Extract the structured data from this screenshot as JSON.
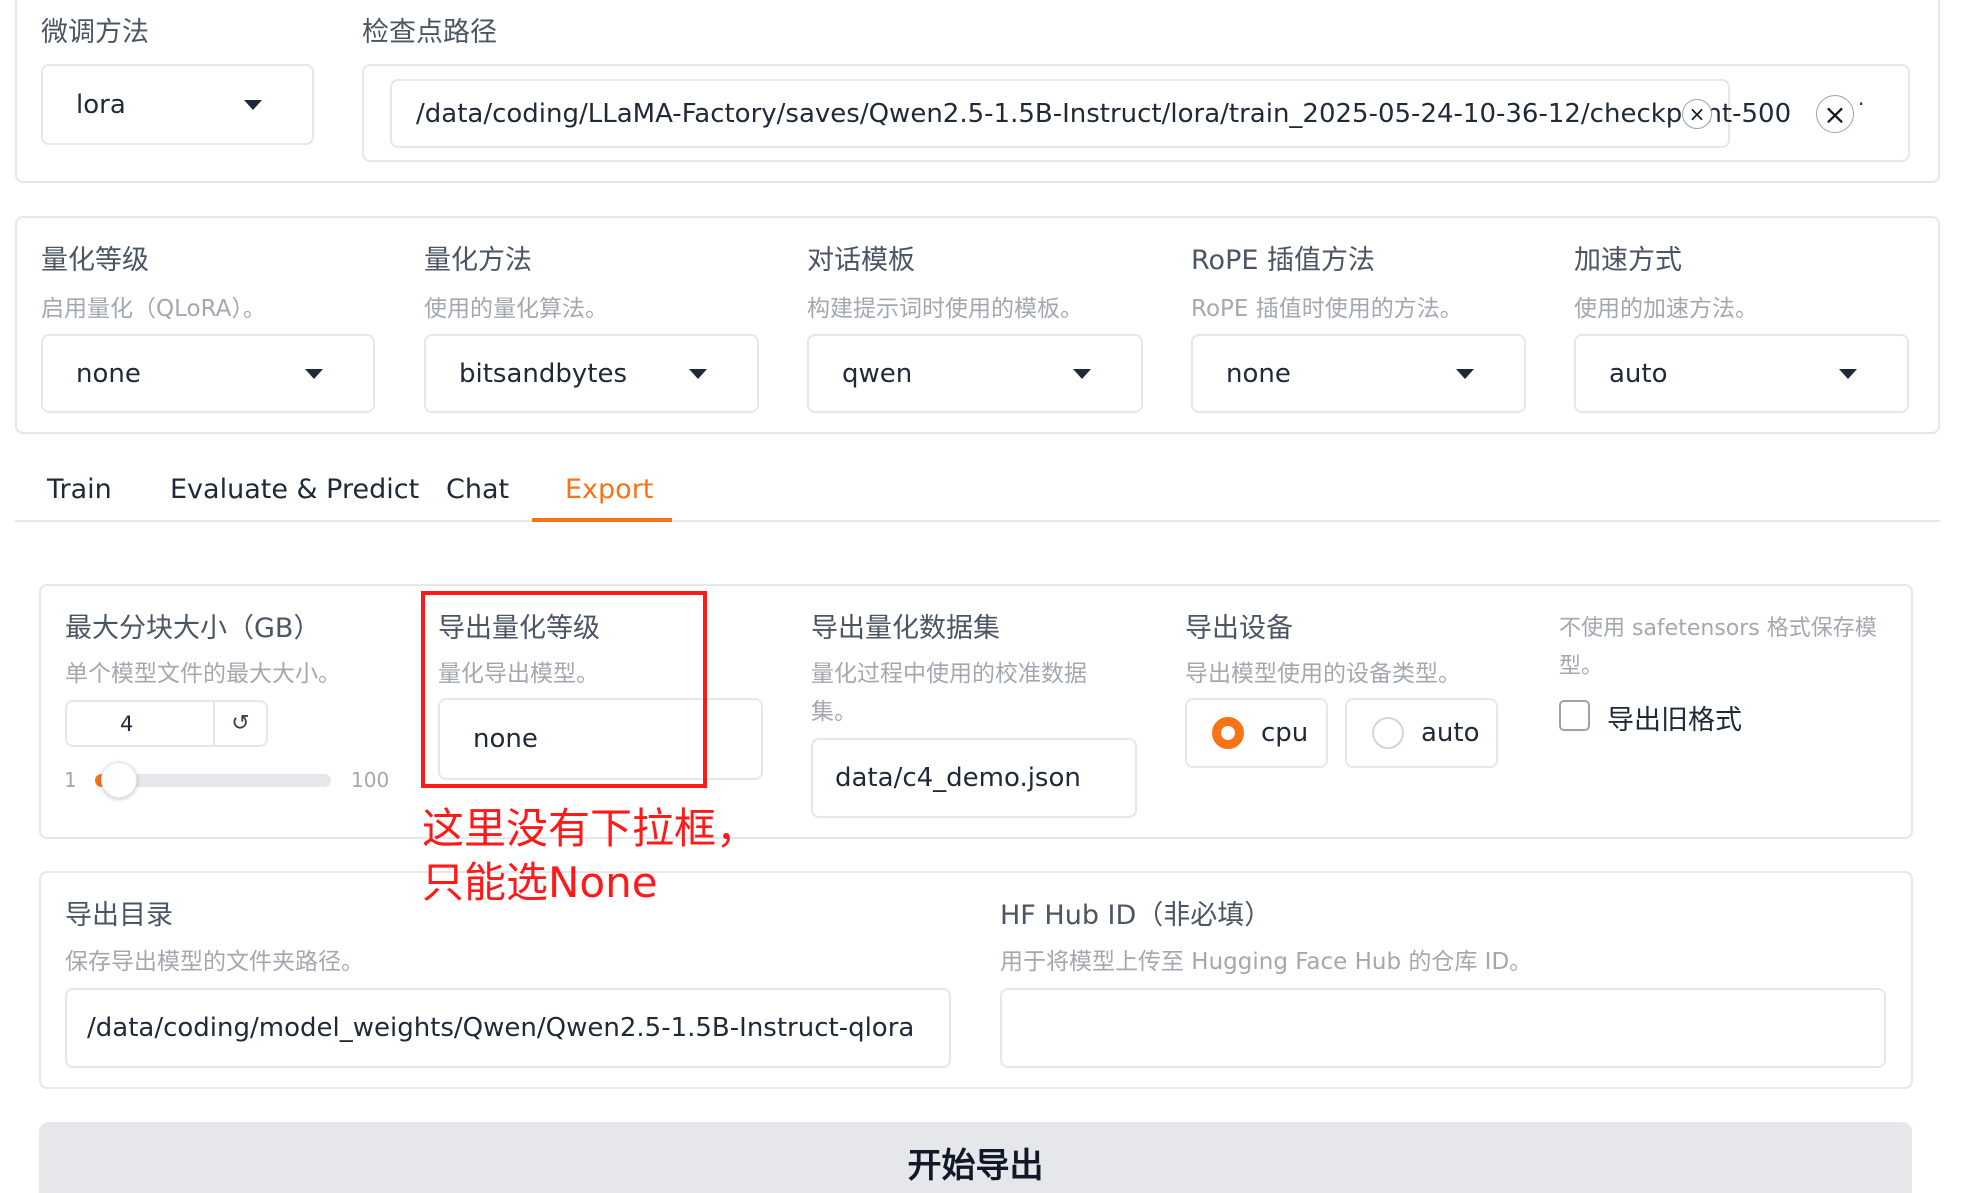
{
  "top": {
    "finetune_label": "微调方法",
    "finetune_value": "lora",
    "checkpoint_label": "检查点路径",
    "checkpoint_value": "/data/coding/LLaMA-Factory/saves/Qwen2.5-1.5B-Instruct/lora/train_2025-05-24-10-36-12/checkpoint-500",
    "chip_clear_icon": "×",
    "clear_all_icon": "×",
    "dropdown_mark": "·"
  },
  "advanced": {
    "quant_bit": {
      "label": "量化等级",
      "info": "启用量化（QLoRA）。",
      "value": "none"
    },
    "quant_method": {
      "label": "量化方法",
      "info": "使用的量化算法。",
      "value": "bitsandbytes"
    },
    "template": {
      "label": "对话模板",
      "info": "构建提示词时使用的模板。",
      "value": "qwen"
    },
    "rope": {
      "label": "RoPE 插值方法",
      "info": "RoPE 插值时使用的方法。",
      "value": "none"
    },
    "booster": {
      "label": "加速方式",
      "info": "使用的加速方法。",
      "value": "auto"
    }
  },
  "tabs": [
    {
      "label": "Train"
    },
    {
      "label": "Evaluate & Predict"
    },
    {
      "label": "Chat"
    },
    {
      "label": "Export"
    }
  ],
  "export": {
    "max_shard": {
      "label": "最大分块大小（GB）",
      "info": "单个模型文件的最大大小。",
      "value": "4",
      "reset_icon": "↺",
      "min": "1",
      "max": "100",
      "slider_fraction": 0.03
    },
    "quant_bit": {
      "label": "导出量化等级",
      "info": "量化导出模型。",
      "value": "none"
    },
    "quant_dataset": {
      "label": "导出量化数据集",
      "info_line1": "量化过程中使用的校准数据",
      "info_line2": "集。",
      "value": "data/c4_demo.json"
    },
    "device": {
      "label": "导出设备",
      "info": "导出模型使用的设备类型。",
      "options": [
        "cpu",
        "auto"
      ],
      "selected": "cpu"
    },
    "legacy": {
      "info_line1": "不使用 safetensors 格式保存模",
      "info_line2": "型。",
      "label": "导出旧格式",
      "checked": false
    },
    "dir": {
      "label": "导出目录",
      "info": "保存导出模型的文件夹路径。",
      "value": "/data/coding/model_weights/Qwen/Qwen2.5-1.5B-Instruct-qlora"
    },
    "hub": {
      "label": "HF Hub ID（非必填）",
      "info": "用于将模型上传至 Hugging Face Hub 的仓库 ID。",
      "value": ""
    },
    "button_label": "开始导出"
  },
  "annotation": {
    "line1": "这里没有下拉框，",
    "line2": "只能选None"
  },
  "colors": {
    "accent": "#f97316",
    "annotation": "#ff1a1a",
    "border": "#e5e7eb"
  }
}
